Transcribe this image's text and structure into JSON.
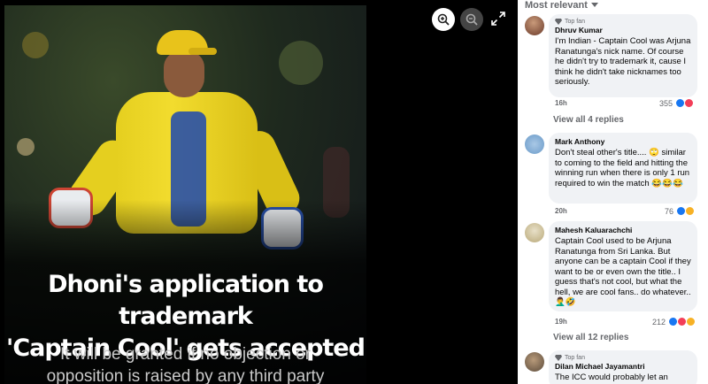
{
  "post": {
    "headline_line1": "Dhoni's application to trademark",
    "headline_line2": "'Captain Cool' gets accepted",
    "subhead_line1": "It will be granted if no objection or",
    "subhead_line2": "opposition is raised by any third party"
  },
  "viewer_controls": {
    "zoom_in_icon": "magnifier-plus",
    "zoom_out_icon": "magnifier-minus",
    "fullscreen_icon": "expand-arrows"
  },
  "sidebar": {
    "sort_label": "Most relevant",
    "comments": [
      {
        "badge": "Top fan",
        "author": "Dhruv Kumar",
        "text": "I'm Indian - Captain Cool was Arjuna Ranatunga's nick name. Of course he didn't try to trademark it, cause I think he didn't take nicknames too seriously.",
        "time": "16h",
        "reactions": "355",
        "replies": "View all 4 replies"
      },
      {
        "badge": "",
        "author": "Mark Anthony",
        "text": "Don't steal other's title.... 🙄 similar to coming to the field and hitting the winning run when there is only 1 run required to win the match 😂😂😂",
        "time": "20h",
        "reactions": "76",
        "replies": ""
      },
      {
        "badge": "",
        "author": "Mahesh Kaluarachchi",
        "text": "Captain Cool used to be Arjuna Ranatunga from Sri Lanka. But anyone can be a captain Cool if they want to be or even own the title.. I guess that's not cool, but what the hell, we are cool fans.. do whatever.. 🤦‍♂️🤣",
        "time": "19h",
        "reactions": "212",
        "replies": "View all 12 replies"
      },
      {
        "badge": "Top fan",
        "author": "Dilan Michael Jayamantri",
        "text": "The ICC would probably let an",
        "time": "",
        "reactions": "",
        "replies": ""
      }
    ]
  },
  "colors": {
    "like_blue": "#1877f2",
    "love_red": "#f33e58",
    "haha_yellow": "#f7b125",
    "bubble_bg": "#f0f2f5",
    "jersey_yellow": "#f2dc2e"
  }
}
